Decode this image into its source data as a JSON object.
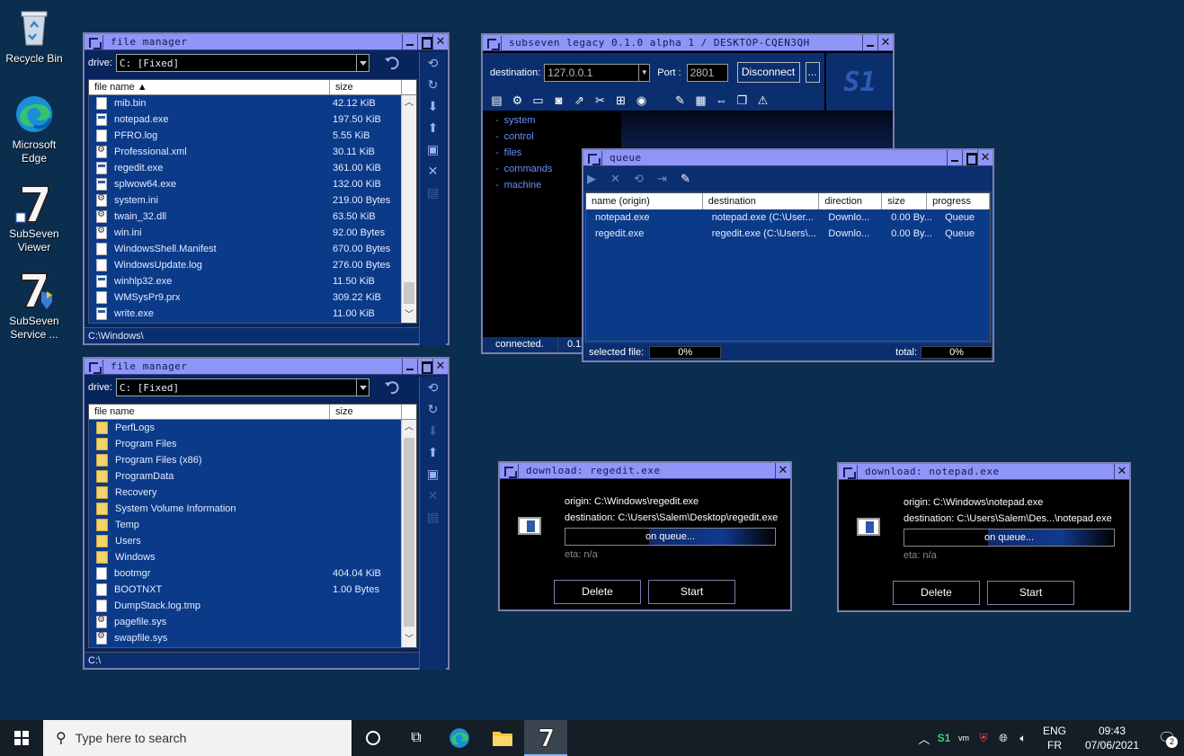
{
  "desktop_icons": [
    {
      "label": "Recycle Bin",
      "icon": "recycle-bin-icon"
    },
    {
      "label": "Microsoft Edge",
      "icon": "edge-icon"
    },
    {
      "label": "SubSeven Viewer",
      "icon": "subseven-icon"
    },
    {
      "label": "SubSeven Service ...",
      "icon": "subseven-service-icon"
    }
  ],
  "fm1": {
    "title": "file manager",
    "drive_label": "drive:",
    "drive_value": "C: [Fixed]",
    "col_name": "file name",
    "col_size": "size",
    "rows": [
      {
        "name": "mib.bin",
        "size": "42.12 KiB",
        "icon": "file"
      },
      {
        "name": "notepad.exe",
        "size": "197.50 KiB",
        "icon": "exe"
      },
      {
        "name": "PFRO.log",
        "size": "5.55 KiB",
        "icon": "file"
      },
      {
        "name": "Professional.xml",
        "size": "30.11 KiB",
        "icon": "gear"
      },
      {
        "name": "regedit.exe",
        "size": "361.00 KiB",
        "icon": "exe"
      },
      {
        "name": "splwow64.exe",
        "size": "132.00 KiB",
        "icon": "exe"
      },
      {
        "name": "system.ini",
        "size": "219.00 Bytes",
        "icon": "gear"
      },
      {
        "name": "twain_32.dll",
        "size": "63.50 KiB",
        "icon": "gear"
      },
      {
        "name": "win.ini",
        "size": "92.00 Bytes",
        "icon": "gear"
      },
      {
        "name": "WindowsShell.Manifest",
        "size": "670.00 Bytes",
        "icon": "file"
      },
      {
        "name": "WindowsUpdate.log",
        "size": "276.00 Bytes",
        "icon": "file"
      },
      {
        "name": "winhlp32.exe",
        "size": "11.50 KiB",
        "icon": "exe"
      },
      {
        "name": "WMSysPr9.prx",
        "size": "309.22 KiB",
        "icon": "file"
      },
      {
        "name": "write.exe",
        "size": "11.00 KiB",
        "icon": "exe"
      }
    ],
    "status": "C:\\Windows\\"
  },
  "fm2": {
    "title": "file manager",
    "drive_label": "drive:",
    "drive_value": "C: [Fixed]",
    "col_name": "file name",
    "col_size": "size",
    "rows": [
      {
        "name": "PerfLogs",
        "size": "",
        "icon": "folder"
      },
      {
        "name": "Program Files",
        "size": "",
        "icon": "folder"
      },
      {
        "name": "Program Files (x86)",
        "size": "",
        "icon": "folder"
      },
      {
        "name": "ProgramData",
        "size": "",
        "icon": "folder"
      },
      {
        "name": "Recovery",
        "size": "",
        "icon": "folder"
      },
      {
        "name": "System Volume Information",
        "size": "",
        "icon": "folder"
      },
      {
        "name": "Temp",
        "size": "",
        "icon": "folder"
      },
      {
        "name": "Users",
        "size": "",
        "icon": "folder"
      },
      {
        "name": "Windows",
        "size": "",
        "icon": "folder"
      },
      {
        "name": "bootmgr",
        "size": "404.04 KiB",
        "icon": "file"
      },
      {
        "name": "BOOTNXT",
        "size": "1.00 Bytes",
        "icon": "file"
      },
      {
        "name": "DumpStack.log.tmp",
        "size": "",
        "icon": "file"
      },
      {
        "name": "pagefile.sys",
        "size": "",
        "icon": "gear"
      },
      {
        "name": "swapfile.sys",
        "size": "",
        "icon": "gear"
      }
    ],
    "status": "C:\\"
  },
  "s7": {
    "title": "subseven legacy 0.1.0 alpha 1 / DESKTOP-CQEN3QH",
    "dest_label": "destination:",
    "dest_value": "127.0.0.1",
    "port_label": "Port :",
    "port_value": "2801",
    "disconnect": "Disconnect",
    "more": "...",
    "logo": "S1",
    "tree": [
      "system",
      "control",
      "files",
      "commands",
      "machine"
    ],
    "status_left": "connected.",
    "status_right": "0.1"
  },
  "queue": {
    "title": "queue",
    "columns": [
      "name (origin)",
      "destination",
      "direction",
      "size",
      "progress"
    ],
    "rows": [
      [
        "notepad.exe",
        "notepad.exe (C:\\User...",
        "Downlo...",
        "0.00 By...",
        "Queue"
      ],
      [
        "regedit.exe",
        "regedit.exe (C:\\Users\\...",
        "Downlo...",
        "0.00 By...",
        "Queue"
      ]
    ],
    "selected_label": "selected file:",
    "selected_pct": "0%",
    "total_label": "total:",
    "total_pct": "0%"
  },
  "dl1": {
    "title": "download: regedit.exe",
    "origin": "origin: C:\\Windows\\regedit.exe",
    "destination": "destination: C:\\Users\\Salem\\Desktop\\regedit.exe",
    "progress_text": "on queue...",
    "eta": "eta: n/a",
    "delete": "Delete",
    "start": "Start"
  },
  "dl2": {
    "title": "download: notepad.exe",
    "origin": "origin: C:\\Windows\\notepad.exe",
    "destination": "destination: C:\\Users\\Salem\\Des...\\notepad.exe",
    "progress_text": "on queue...",
    "eta": "eta: n/a",
    "delete": "Delete",
    "start": "Start"
  },
  "taskbar": {
    "search_placeholder": "Type here to search",
    "lang_top": "ENG",
    "lang_bottom": "FR",
    "time": "09:43",
    "date": "07/06/2021",
    "notif_count": "2"
  }
}
